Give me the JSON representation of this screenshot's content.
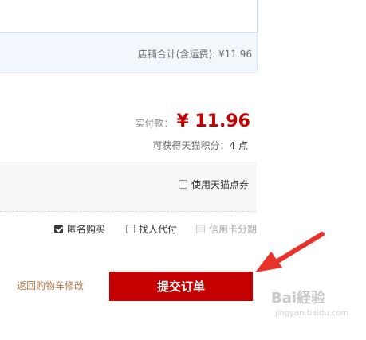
{
  "store": {
    "total_text": "店铺合计(含运费): ¥11.96"
  },
  "payment": {
    "label": "实付款：",
    "amount": "¥ 11.96",
    "points_label": "可获得天猫积分：",
    "points_value": "4 点"
  },
  "coupon": {
    "label": "使用天猫点券",
    "checked": false
  },
  "options": [
    {
      "label": "匿名购买",
      "checked": true,
      "disabled": false
    },
    {
      "label": "找人代付",
      "checked": false,
      "disabled": false
    },
    {
      "label": "信用卡分期",
      "checked": false,
      "disabled": true
    }
  ],
  "actions": {
    "back_link": "返回购物车修改",
    "submit": "提交订单"
  },
  "colors": {
    "accent": "#c40000",
    "link": "#b07a4a"
  },
  "watermark": {
    "text": "Bai経验",
    "url": "jingyan.baidu.com"
  }
}
